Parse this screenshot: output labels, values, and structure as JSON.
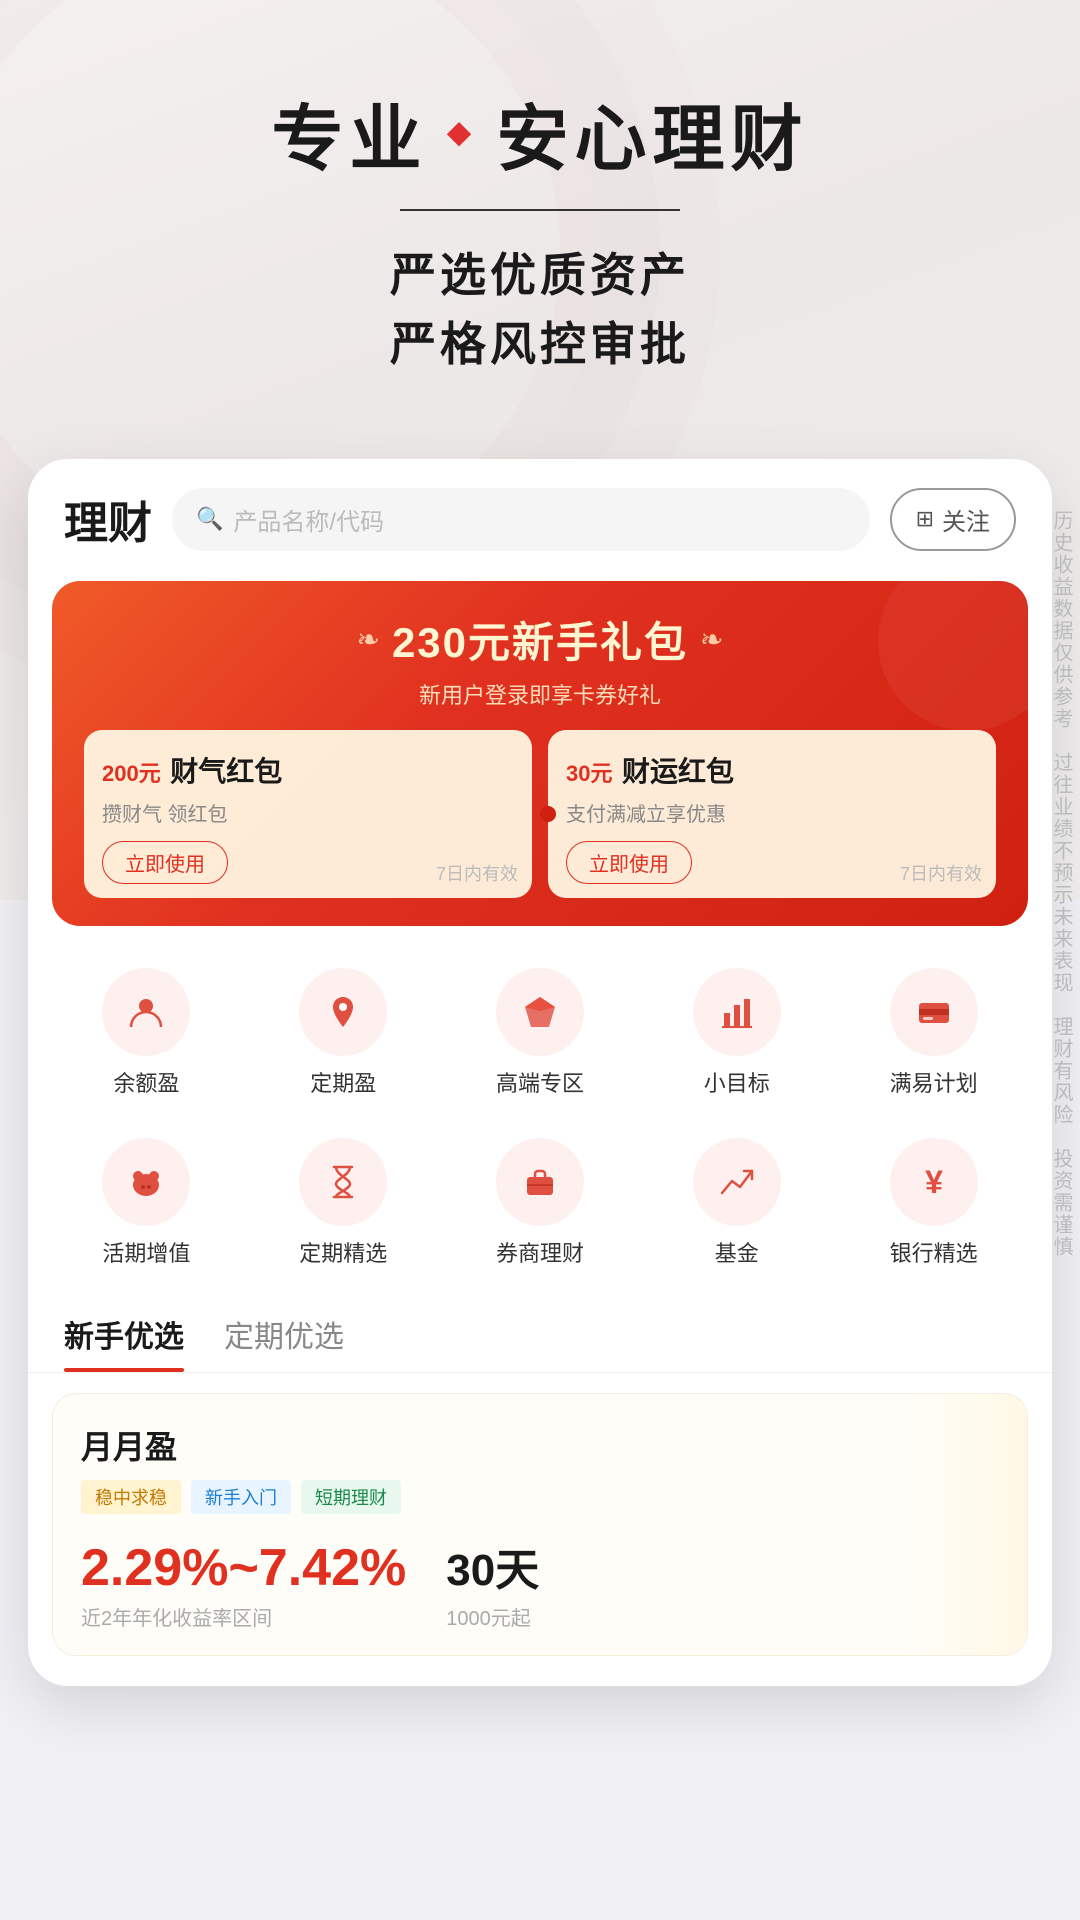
{
  "hero": {
    "title_left": "专业",
    "diamond": "◆",
    "title_right": "安心理财",
    "subtitle_line1": "严选优质资产",
    "subtitle_line2": "严格风控审批"
  },
  "app": {
    "logo": "理财",
    "search_placeholder": "产品名称/代码",
    "follow_label": "关注",
    "follow_icon": "⊞"
  },
  "banner": {
    "leaf_left": "❧",
    "leaf_right": "❧",
    "title": "230元新手礼包",
    "subtitle": "新用户登录即享卡券好礼",
    "card1": {
      "amount": "200",
      "unit": "元",
      "type_label": "财气红包",
      "desc": "攒财气 领红包",
      "btn": "立即使用",
      "expire": "7日内有效"
    },
    "card2": {
      "amount": "30",
      "unit": "元",
      "type_label": "财运红包",
      "desc": "支付满减立享优惠",
      "btn": "立即使用",
      "expire": "7日内有效"
    }
  },
  "icon_row1": [
    {
      "id": "yuebao",
      "icon": "👤",
      "label": "余额盈"
    },
    {
      "id": "dingqi",
      "icon": "📍",
      "label": "定期盈"
    },
    {
      "id": "gaoduan",
      "icon": "💎",
      "label": "高端专区"
    },
    {
      "id": "xiaomubiao",
      "icon": "📊",
      "label": "小目标"
    },
    {
      "id": "manyi",
      "icon": "💳",
      "label": "满易计划"
    }
  ],
  "icon_row2": [
    {
      "id": "huoqi",
      "icon": "🐷",
      "label": "活期增值"
    },
    {
      "id": "dingqijx",
      "icon": "⏳",
      "label": "定期精选"
    },
    {
      "id": "quanshang",
      "icon": "💼",
      "label": "券商理财"
    },
    {
      "id": "jijin",
      "icon": "📈",
      "label": "基金"
    },
    {
      "id": "yinhang",
      "icon": "¥",
      "label": "银行精选"
    }
  ],
  "tabs": [
    {
      "id": "xinshou",
      "label": "新手优选",
      "active": true
    },
    {
      "id": "dingqi",
      "label": "定期优选",
      "active": false
    }
  ],
  "product": {
    "name": "月月盈",
    "tags": [
      {
        "text": "稳中求稳",
        "style": "yellow"
      },
      {
        "text": "新手入门",
        "style": "blue"
      },
      {
        "text": "短期理财",
        "style": "green"
      }
    ],
    "rate": "2.29%~7.42%",
    "rate_label": "近2年年化收益率区间",
    "period": "30天",
    "period_label": "1000元起"
  },
  "side_text": {
    "lines": [
      "历史收益数据仅供参考",
      "过往业绩不预示未来表现",
      "理财有风险",
      "投资需谨慎"
    ]
  }
}
